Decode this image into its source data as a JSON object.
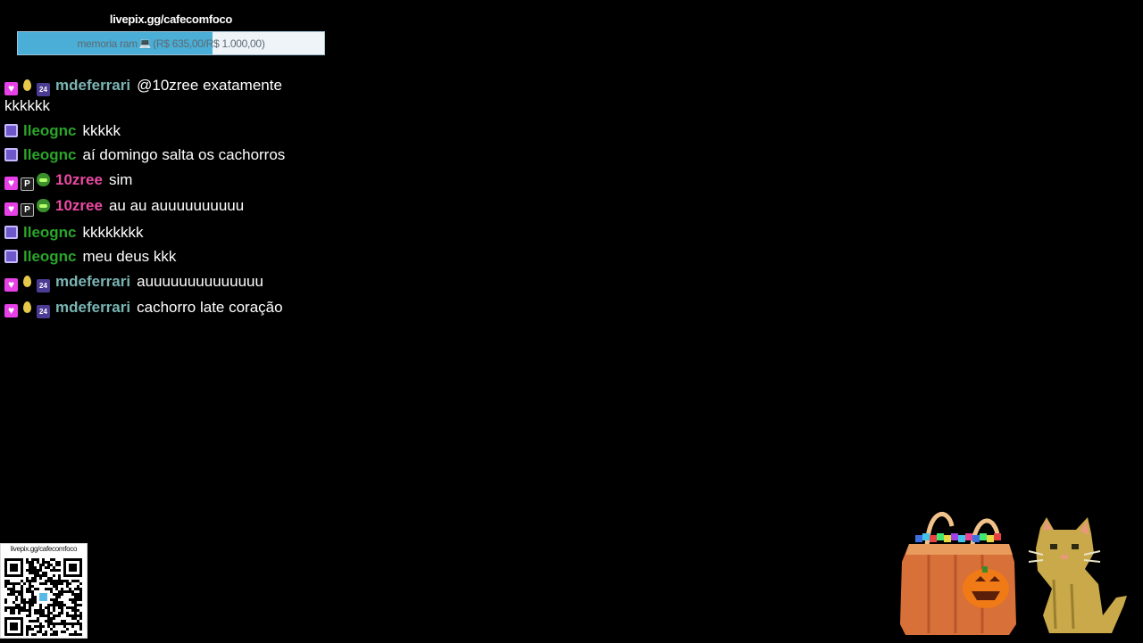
{
  "goal": {
    "url": "livepix.gg/cafecomfoco",
    "title": "memoria ram",
    "current": "R$ 635,00",
    "target": "R$ 1.000,00",
    "progress_fraction": 0.635,
    "fill_color": "#4aaed6",
    "icon": "laptop-emoji"
  },
  "chat": {
    "messages": [
      {
        "user": "mdeferrari",
        "color": "#7ab5b4",
        "badges": [
          "heart",
          "drop",
          "24"
        ],
        "text": "@10zree exatamente kkkkkk"
      },
      {
        "user": "lleognc",
        "color": "#2aa52a",
        "badges": [
          "pixel"
        ],
        "text": "kkkkk"
      },
      {
        "user": "lleognc",
        "color": "#2aa52a",
        "badges": [
          "pixel"
        ],
        "text": "aí domingo salta os cachorros"
      },
      {
        "user": "10zree",
        "color": "#ec4aa4",
        "badges": [
          "heart",
          "p",
          "bot"
        ],
        "text": "sim"
      },
      {
        "user": "10zree",
        "color": "#ec4aa4",
        "badges": [
          "heart",
          "p",
          "bot"
        ],
        "text": "au au auuuuuuuuuu"
      },
      {
        "user": "lleognc",
        "color": "#2aa52a",
        "badges": [
          "pixel"
        ],
        "text": "kkkkkkkk"
      },
      {
        "user": "lleognc",
        "color": "#2aa52a",
        "badges": [
          "pixel"
        ],
        "text": "meu deus kkk"
      },
      {
        "user": "mdeferrari",
        "color": "#7ab5b4",
        "badges": [
          "heart",
          "drop",
          "24"
        ],
        "text": "auuuuuuuuuuuuuu"
      },
      {
        "user": "mdeferrari",
        "color": "#7ab5b4",
        "badges": [
          "heart",
          "drop",
          "24"
        ],
        "text": "cachorro late coração"
      }
    ]
  },
  "qr": {
    "label": "livepix.gg/cafecomfoco"
  },
  "decoration": {
    "items": [
      "pumpkin-candy-bucket",
      "pixel-cat"
    ]
  }
}
